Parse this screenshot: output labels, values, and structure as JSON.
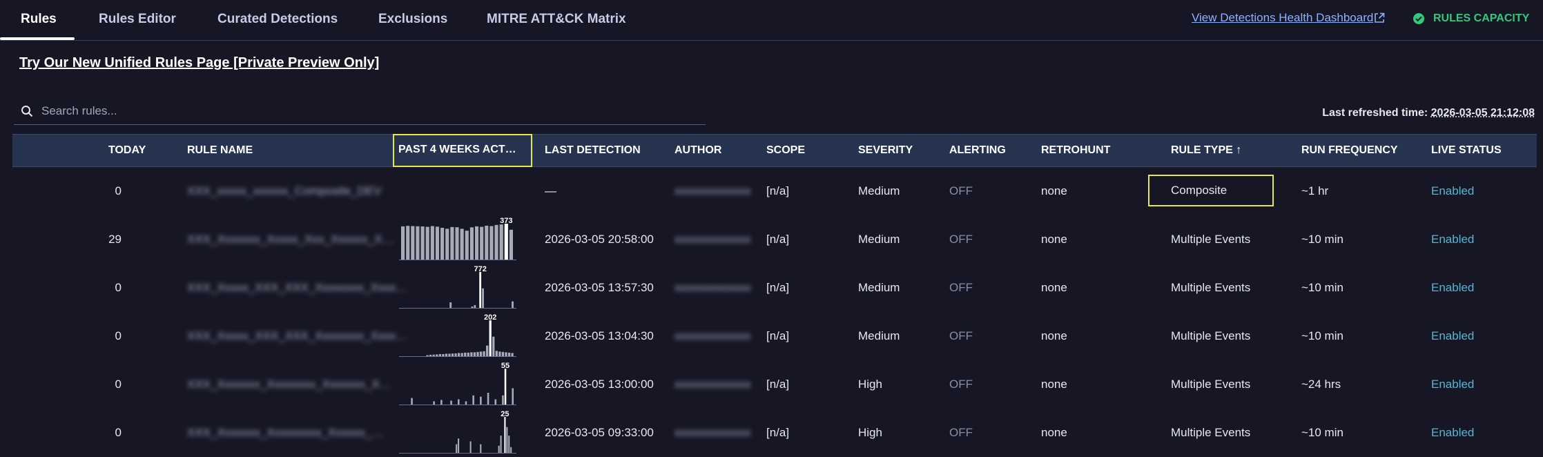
{
  "tabs": [
    "Rules",
    "Rules Editor",
    "Curated Detections",
    "Exclusions",
    "MITRE ATT&CK Matrix"
  ],
  "health_link": "View Detections Health Dashboard",
  "capacity_label": "RULES CAPACITY",
  "preview_link": "Try Our New Unified Rules Page [Private Preview Only]",
  "search_placeholder": "Search rules...",
  "refreshed_label": "Last refreshed time:",
  "refreshed_value": "2026-03-05 21:12:08",
  "columns": [
    "TODAY",
    "RULE NAME",
    "PAST 4 WEEKS ACT…",
    "LAST DETECTION",
    "AUTHOR",
    "SCOPE",
    "SEVERITY",
    "ALERTING",
    "RETROHUNT",
    "RULE TYPE ↑",
    "RUN FREQUENCY",
    "LIVE STATUS"
  ],
  "rows": [
    {
      "today": "0",
      "name": "XXX_xxxxx_xxxxxx_Composite_DEV",
      "peak": "",
      "activity": [],
      "last_detection": "—",
      "author": "xxxxxxxxxxxxx",
      "scope": "[n/a]",
      "severity": "Medium",
      "alerting": "OFF",
      "retrohunt": "none",
      "rule_type": "Composite",
      "run_frequency": "~1 hr",
      "live_status": "Enabled"
    },
    {
      "today": "29",
      "name": "XXX_Xxxxxxx_Xxxxx_Xxx_Xxxxxx_X…",
      "peak": "373",
      "activity": [
        345,
        350,
        348,
        346,
        344,
        340,
        348,
        342,
        330,
        320,
        338,
        336,
        320,
        300,
        335,
        345,
        340,
        352,
        348,
        360,
        365,
        373,
        310
      ],
      "last_detection": "2026-03-05 20:58:00",
      "author": "xxxxxxxxxxxxx",
      "scope": "[n/a]",
      "severity": "Medium",
      "alerting": "OFF",
      "retrohunt": "none",
      "rule_type": "Multiple Events",
      "run_frequency": "~10 min",
      "live_status": "Enabled"
    },
    {
      "today": "0",
      "name": "XXX_Xxxxx_XXX_XXX_Xxxxxxxx_Xxxx…",
      "peak": "772",
      "activity": [
        0,
        0,
        0,
        0,
        0,
        0,
        0,
        0,
        0,
        0,
        0,
        0,
        0,
        0,
        0,
        0,
        0,
        0,
        120,
        0,
        0,
        0,
        0,
        0,
        0,
        0,
        30,
        60,
        0,
        772,
        420,
        0,
        0,
        0,
        0,
        0,
        0,
        0,
        0,
        0,
        0,
        140
      ],
      "last_detection": "2026-03-05 13:57:30",
      "author": "xxxxxxxxxxxxx",
      "scope": "[n/a]",
      "severity": "Medium",
      "alerting": "OFF",
      "retrohunt": "none",
      "rule_type": "Multiple Events",
      "run_frequency": "~10 min",
      "live_status": "Enabled"
    },
    {
      "today": "0",
      "name": "XXX_Xxxxx_XXX_XXX_Xxxxxxxx_Xxxx…",
      "peak": "202",
      "activity": [
        0,
        0,
        0,
        0,
        0,
        0,
        0,
        0,
        6,
        8,
        9,
        10,
        12,
        12,
        14,
        14,
        15,
        16,
        18,
        18,
        20,
        20,
        22,
        22,
        24,
        26,
        28,
        60,
        202,
        110,
        30,
        26,
        24,
        22,
        20,
        18
      ],
      "last_detection": "2026-03-05 13:04:30",
      "author": "xxxxxxxxxxxxx",
      "scope": "[n/a]",
      "severity": "Medium",
      "alerting": "OFF",
      "retrohunt": "none",
      "rule_type": "Multiple Events",
      "run_frequency": "~10 min",
      "live_status": "Enabled"
    },
    {
      "today": "0",
      "name": "XXX_Xxxxxxx_Xxxxxxxx_Xxxxxxx_X…",
      "peak": "55",
      "activity": [
        0,
        0,
        0,
        0,
        10,
        0,
        0,
        0,
        0,
        0,
        0,
        0,
        0,
        5,
        0,
        0,
        7,
        0,
        0,
        0,
        6,
        0,
        0,
        8,
        0,
        0,
        5,
        0,
        0,
        14,
        0,
        0,
        12,
        0,
        0,
        18,
        0,
        0,
        8,
        0,
        0,
        14,
        55,
        0,
        0,
        25
      ],
      "last_detection": "2026-03-05 13:00:00",
      "author": "xxxxxxxxxxxxx",
      "scope": "[n/a]",
      "severity": "High",
      "alerting": "OFF",
      "retrohunt": "none",
      "rule_type": "Multiple Events",
      "run_frequency": "~24 hrs",
      "live_status": "Enabled"
    },
    {
      "today": "0",
      "name": "XXX_Xxxxxxx_Xxxxxxxxx_Xxxxxx_…",
      "peak": "25",
      "activity": [
        0,
        0,
        0,
        0,
        0,
        0,
        0,
        0,
        0,
        0,
        0,
        0,
        0,
        0,
        0,
        0,
        0,
        0,
        0,
        0,
        0,
        0,
        0,
        0,
        0,
        0,
        0,
        6,
        10,
        0,
        0,
        0,
        0,
        0,
        8,
        0,
        0,
        0,
        0,
        6,
        0,
        0,
        0,
        0,
        0,
        0,
        0,
        0,
        5,
        12,
        0,
        25,
        18,
        12,
        4,
        0
      ],
      "last_detection": "2026-03-05 09:33:00",
      "author": "xxxxxxxxxxxxx",
      "scope": "[n/a]",
      "severity": "High",
      "alerting": "OFF",
      "retrohunt": "none",
      "rule_type": "Multiple Events",
      "run_frequency": "~10 min",
      "live_status": "Enabled"
    }
  ]
}
